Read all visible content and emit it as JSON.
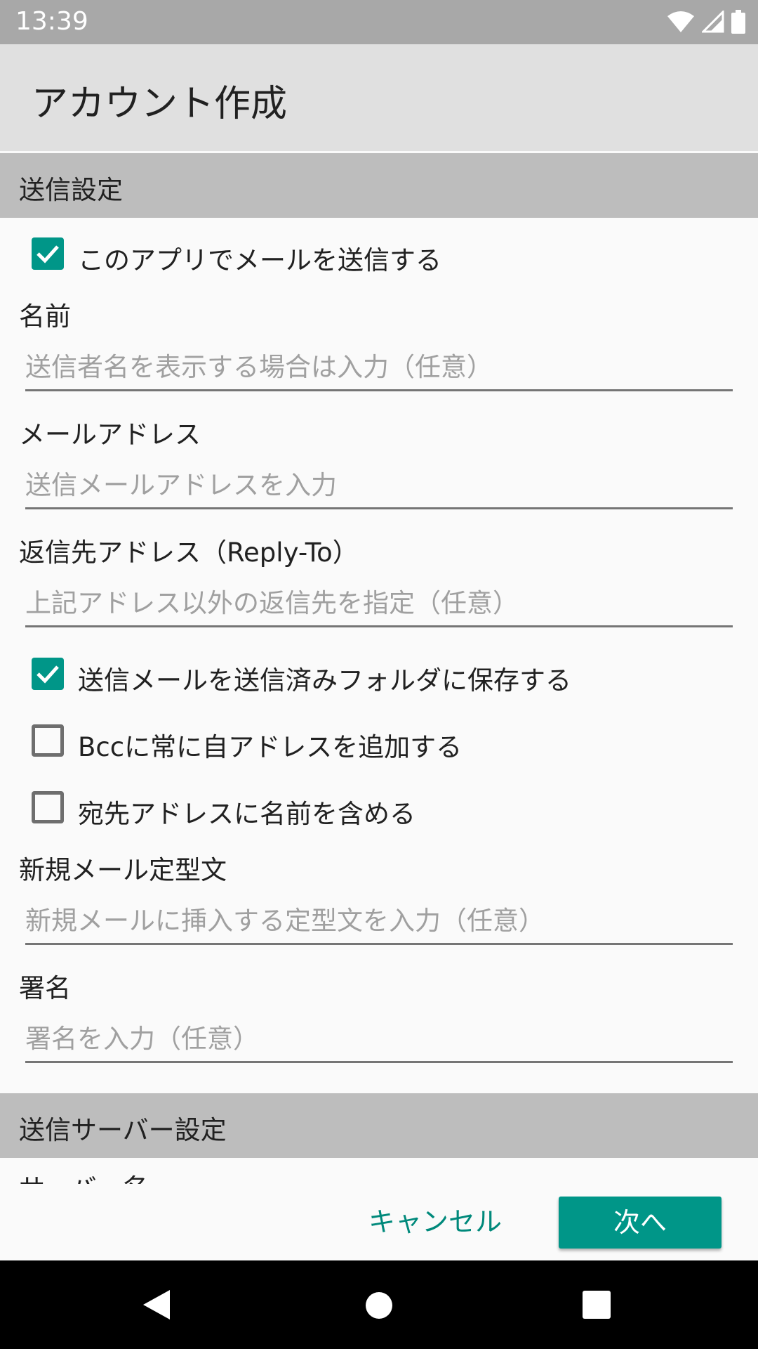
{
  "status_bar": {
    "time": "13:39"
  },
  "app_bar": {
    "title": "アカウント作成"
  },
  "sections": {
    "send_settings": "送信設定",
    "send_server_settings": "送信サーバー設定"
  },
  "form": {
    "send_with_app": {
      "label": "このアプリでメールを送信する",
      "checked": true
    },
    "name": {
      "label": "名前",
      "placeholder": "送信者名を表示する場合は入力（任意）"
    },
    "email": {
      "label": "メールアドレス",
      "placeholder": "送信メールアドレスを入力"
    },
    "reply_to": {
      "label": "返信先アドレス（Reply-To）",
      "placeholder": "上記アドレス以外の返信先を指定（任意）"
    },
    "save_sent": {
      "label": "送信メールを送信済みフォルダに保存する",
      "checked": true
    },
    "bcc_self": {
      "label": "Bccに常に自アドレスを追加する",
      "checked": false
    },
    "include_name": {
      "label": "宛先アドレスに名前を含める",
      "checked": false
    },
    "template": {
      "label": "新規メール定型文",
      "placeholder": "新規メールに挿入する定型文を入力（任意）"
    },
    "signature": {
      "label": "署名",
      "placeholder": "署名を入力（任意）"
    },
    "server_name": {
      "label": "サーバー名"
    }
  },
  "buttons": {
    "cancel": "キャンセル",
    "next": "次へ"
  },
  "colors": {
    "accent": "#009688",
    "section_bg": "#bdbdbd",
    "app_bar_bg": "#e0e0e0",
    "status_bar_bg": "#a8a8a8"
  },
  "icons": {
    "status": [
      "wifi-icon",
      "signal-icon",
      "battery-icon"
    ],
    "nav": [
      "back-icon",
      "home-icon",
      "recents-icon"
    ]
  }
}
